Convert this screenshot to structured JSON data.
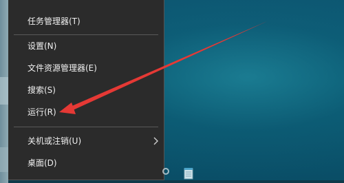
{
  "menu": {
    "items": [
      {
        "label": "任务管理器(T)"
      },
      {
        "label": "设置(N)"
      },
      {
        "label": "文件资源管理器(E)"
      },
      {
        "label": "搜索(S)"
      },
      {
        "label": "运行(R)"
      },
      {
        "label": "关机或注销(U)",
        "has_submenu": true
      },
      {
        "label": "桌面(D)"
      }
    ]
  },
  "colors": {
    "menu_background": "#2b2b2b",
    "menu_text": "#f0f0f0",
    "annotation_arrow": "#e53935",
    "desktop": "#0b5670"
  },
  "icons": {
    "submenu": "chevron-right-icon",
    "taskbar": "notepad-icon"
  }
}
